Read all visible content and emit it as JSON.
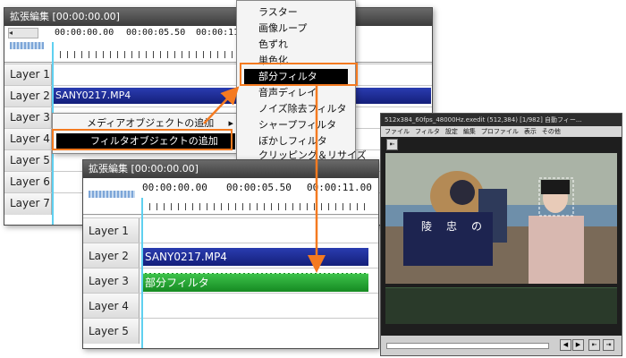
{
  "window1": {
    "title": "拡張編集 [00:00:00.00]",
    "scroll_glyph": "◂",
    "timecodes": [
      "00:00:00.00",
      "00:00:05.50",
      "00:00:11.00"
    ],
    "layers": [
      "Layer 1",
      "Layer 2",
      "Layer 3",
      "Layer 4",
      "Layer 5",
      "Layer 6",
      "Layer 7"
    ],
    "clip_label": "SANY0217.MP4"
  },
  "context_menu": {
    "items": [
      "メディアオブジェクトの追加",
      "フィルタオブジェクトの追加"
    ],
    "submenu_arrow": "▸"
  },
  "filter_menu": {
    "items": [
      "ラスター",
      "画像ループ",
      "色ずれ",
      "単色化",
      "部分フィルタ",
      "音声ディレイ",
      "ノイズ除去フィルタ",
      "シャープフィルタ",
      "ぼかしフィルタ",
      "クリッピング＆リサイズ"
    ],
    "selected_index": 4
  },
  "window2": {
    "title": "拡張編集 [00:00:00.00]",
    "timecodes": [
      "00:00:00.00",
      "00:00:05.50",
      "00:00:11.00"
    ],
    "layers": [
      "Layer 1",
      "Layer 2",
      "Layer 3",
      "Layer 4",
      "Layer 5"
    ],
    "clip_label": "SANY0217.MP4",
    "filter_clip_label": "部分フィルタ"
  },
  "player": {
    "title": "512x384_60fps_48000Hz.exedit (512,384) [1/982] 自動フィー...",
    "menu": [
      "ファイル",
      "フィルタ",
      "設定",
      "編集",
      "プロファイル",
      "表示",
      "その他"
    ],
    "back_glyph": "⇤",
    "controls": [
      "◀",
      "▶",
      "⇤",
      "⇥"
    ],
    "banner_text": [
      "陵",
      "忠",
      "の"
    ]
  },
  "colors": {
    "accent": "#f47a20",
    "media_clip": "#1a2a9a",
    "filter_clip": "#23a23a",
    "playhead": "#5fd0f0"
  }
}
